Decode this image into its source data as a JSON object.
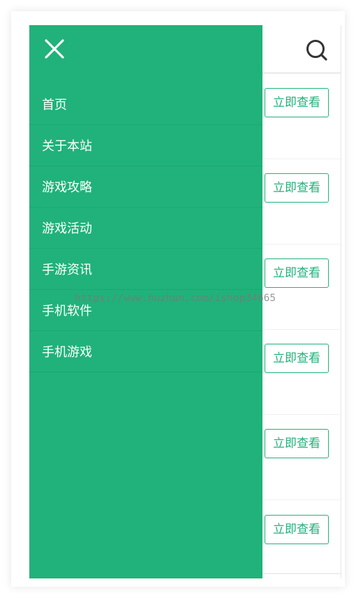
{
  "content": {
    "button_label": "立即查看",
    "rows": [
      {
        "button": "立即查看"
      },
      {
        "button": "立即查看"
      },
      {
        "button": "立即查看"
      },
      {
        "button": "立即查看"
      },
      {
        "button": "立即查看"
      },
      {
        "button": "立即查看"
      }
    ]
  },
  "drawer": {
    "close_icon": "close-icon",
    "items": [
      {
        "label": "首页"
      },
      {
        "label": "关于本站"
      },
      {
        "label": "游戏攻略"
      },
      {
        "label": "游戏活动"
      },
      {
        "label": "手游资讯"
      },
      {
        "label": "手机软件"
      },
      {
        "label": "手机游戏"
      }
    ]
  },
  "header": {
    "search_icon": "search-icon"
  },
  "watermark": "https://www.huzhan.com/ishop34665",
  "colors": {
    "accent": "#20b27a",
    "text_on_accent": "#ffffff",
    "border": "#eeeeee"
  }
}
